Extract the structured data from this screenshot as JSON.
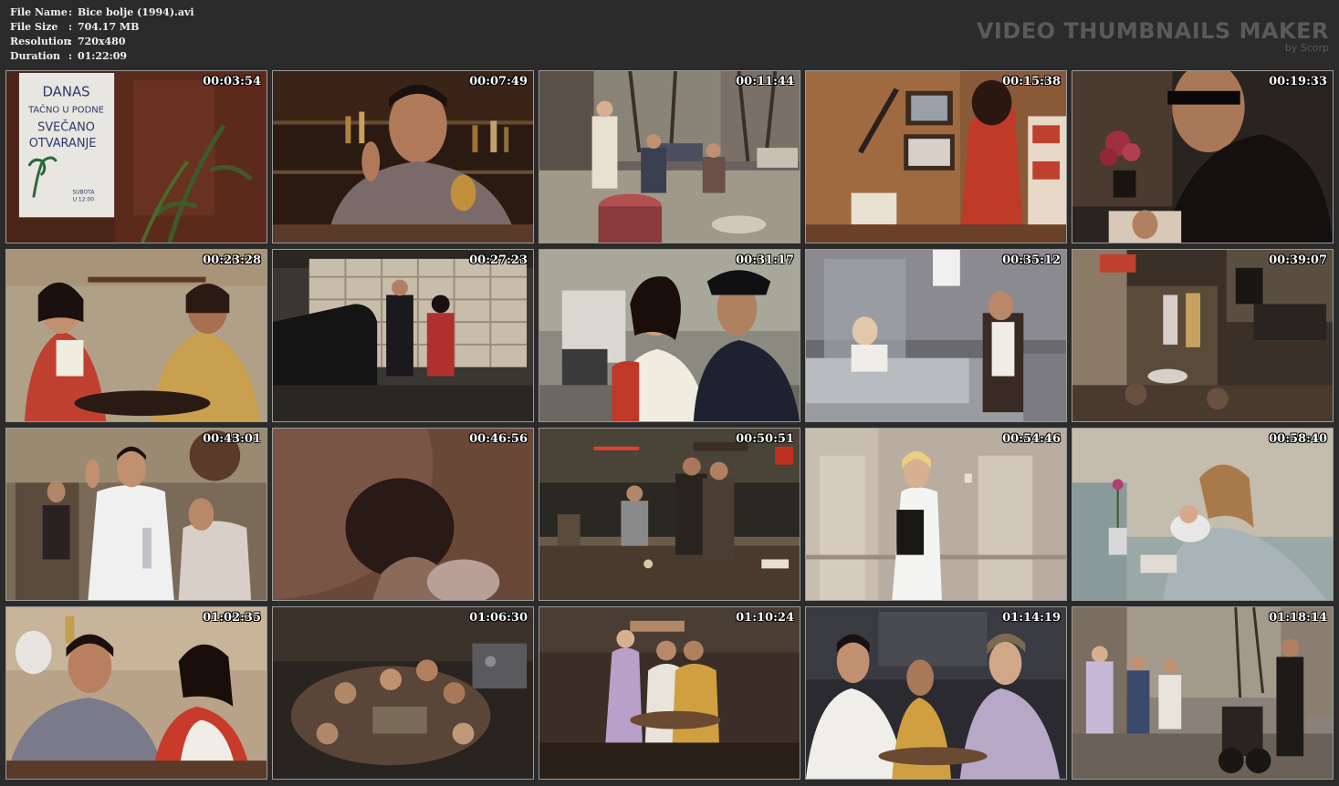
{
  "info": {
    "rows": [
      {
        "label": "File Name",
        "sep": ":",
        "value": "Bice bolje (1994).avi"
      },
      {
        "label": "File Size",
        "sep": ":",
        "value": "704.17 MB"
      },
      {
        "label": "Resolution",
        "sep": ":",
        "value": "720x480"
      },
      {
        "label": "Duration",
        "sep": ":",
        "value": "01:22:09"
      }
    ]
  },
  "brand": {
    "title": "VIDEO THUMBNAILS MAKER",
    "subtitle": "by Scorp"
  },
  "thumbnails": [
    {
      "time": "00:03:54"
    },
    {
      "time": "00:07:49"
    },
    {
      "time": "00:11:44"
    },
    {
      "time": "00:15:38"
    },
    {
      "time": "00:19:33"
    },
    {
      "time": "00:23:28"
    },
    {
      "time": "00:27:23"
    },
    {
      "time": "00:31:17"
    },
    {
      "time": "00:35:12"
    },
    {
      "time": "00:39:07"
    },
    {
      "time": "00:43:01"
    },
    {
      "time": "00:46:56"
    },
    {
      "time": "00:50:51"
    },
    {
      "time": "00:54:46"
    },
    {
      "time": "00:58:40"
    },
    {
      "time": "01:02:35"
    },
    {
      "time": "01:06:30"
    },
    {
      "time": "01:10:24"
    },
    {
      "time": "01:14:19"
    },
    {
      "time": "01:18:14"
    }
  ],
  "sign_text": {
    "line1": "DANAS",
    "line2": "TAČNO U PODNE",
    "line3": "SVEČANO",
    "line4": "OTVARANJE",
    "line5": "SUBOTA",
    "line6": "U 12:00"
  },
  "colors": {
    "background": "#2b2b2b",
    "info_text": "#f0f0f0",
    "brand_text": "#5a5a5a",
    "timestamp": "#ffffff",
    "thumb_border": "#9a9a9a"
  }
}
